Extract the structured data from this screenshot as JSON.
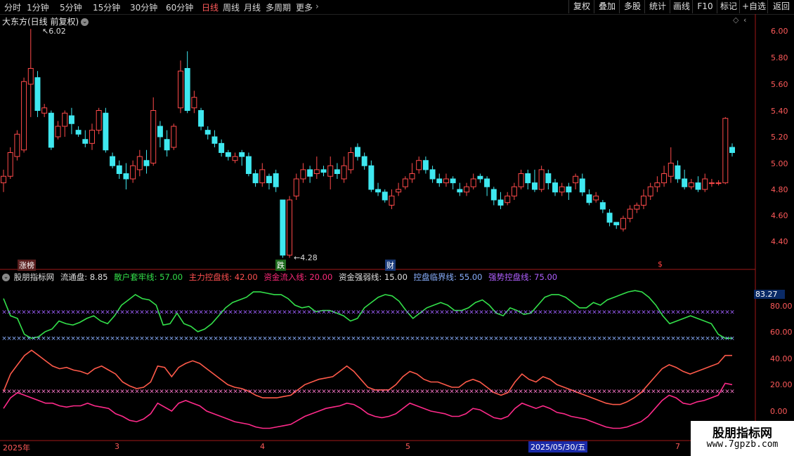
{
  "toolbar": {
    "periods": [
      "分时",
      "1分钟",
      "5分钟",
      "15分钟",
      "30分钟",
      "60分钟",
      "日线",
      "周线",
      "月线",
      "多周期",
      "更多"
    ],
    "active_period": "日线",
    "buttons": [
      "复权",
      "叠加",
      "多股",
      "统计",
      "画线",
      "F10",
      "标记",
      "+自选",
      "返回"
    ]
  },
  "chart_title": "大东方(日线 前复权)",
  "annotations": {
    "high": "6.02",
    "low": "4.28",
    "tag_zhangbang": "涨榜",
    "tag_die": "跌",
    "tag_cai": "财",
    "tag_dollar": "$"
  },
  "indicator": {
    "name": "股朋指标网",
    "float_label": "流通盘: 8.85",
    "items": [
      {
        "text": "散户套牢线: 57.00",
        "color": "#33e04a"
      },
      {
        "text": "主力控盘线: 42.00",
        "color": "#ff5050"
      },
      {
        "text": "资金流入线: 20.00",
        "color": "#ff2a7a"
      },
      {
        "text": "资金强弱线: 15.00",
        "color": "#e0e0e0"
      },
      {
        "text": "控盘临界线: 55.00",
        "color": "#8ab0ff"
      },
      {
        "text": "强势控盘线: 75.00",
        "color": "#b060ff"
      }
    ],
    "current_value": "83.27"
  },
  "price_axis": [
    "6.00",
    "5.80",
    "5.60",
    "5.40",
    "5.20",
    "5.00",
    "4.80",
    "4.60",
    "4.40"
  ],
  "ind_axis": [
    "80.00",
    "60.00",
    "40.00",
    "20.00",
    "0.00"
  ],
  "x_axis": [
    "2025年",
    "3",
    "4",
    "5",
    "7"
  ],
  "cursor_date": "2025/05/30/五",
  "watermark": {
    "title": "股朋指标网",
    "url": "www.7gpzb.com"
  },
  "chart_data": {
    "type": "candlestick",
    "price_ylim": [
      4.2,
      6.1
    ],
    "candles": [
      [
        4.85,
        4.9,
        4.78,
        4.95
      ],
      [
        4.9,
        5.08,
        4.88,
        5.12
      ],
      [
        5.05,
        5.22,
        5.02,
        5.25
      ],
      [
        5.1,
        5.62,
        5.08,
        5.65
      ],
      [
        5.6,
        5.72,
        5.35,
        6.02
      ],
      [
        5.65,
        5.4,
        5.35,
        5.7
      ],
      [
        5.38,
        5.42,
        5.35,
        5.45
      ],
      [
        5.38,
        5.12,
        5.1,
        5.4
      ],
      [
        5.2,
        5.28,
        5.18,
        5.32
      ],
      [
        5.28,
        5.38,
        5.2,
        5.4
      ],
      [
        5.36,
        5.3,
        5.22,
        5.42
      ],
      [
        5.25,
        5.22,
        5.2,
        5.28
      ],
      [
        5.18,
        5.15,
        5.12,
        5.25
      ],
      [
        5.15,
        5.25,
        5.1,
        5.3
      ],
      [
        5.25,
        5.4,
        5.22,
        5.42
      ],
      [
        5.38,
        5.1,
        5.08,
        5.42
      ],
      [
        5.05,
        4.98,
        4.96,
        5.08
      ],
      [
        4.98,
        4.92,
        4.88,
        5.02
      ],
      [
        4.92,
        4.88,
        4.8,
        5.0
      ],
      [
        4.88,
        4.98,
        4.85,
        5.02
      ],
      [
        4.95,
        5.05,
        4.9,
        5.1
      ],
      [
        5.02,
        4.98,
        4.92,
        5.1
      ],
      [
        5.0,
        5.4,
        4.98,
        5.5
      ],
      [
        5.28,
        5.2,
        5.12,
        5.32
      ],
      [
        5.18,
        5.1,
        5.05,
        5.25
      ],
      [
        5.12,
        5.28,
        5.1,
        5.3
      ],
      [
        5.42,
        5.7,
        5.38,
        5.78
      ],
      [
        5.72,
        5.4,
        5.38,
        5.85
      ],
      [
        5.42,
        5.5,
        5.38,
        5.55
      ],
      [
        5.4,
        5.28,
        5.25,
        5.42
      ],
      [
        5.25,
        5.22,
        5.18,
        5.28
      ],
      [
        5.2,
        5.15,
        5.12,
        5.25
      ],
      [
        5.15,
        5.08,
        5.05,
        5.18
      ],
      [
        5.08,
        5.05,
        5.02,
        5.1
      ],
      [
        5.02,
        5.05,
        5.0,
        5.08
      ],
      [
        5.08,
        5.05,
        4.98,
        5.1
      ],
      [
        5.05,
        4.92,
        4.9,
        5.08
      ],
      [
        4.92,
        4.85,
        4.82,
        4.95
      ],
      [
        4.85,
        4.95,
        4.82,
        5.0
      ],
      [
        4.9,
        4.85,
        4.8,
        4.92
      ],
      [
        4.92,
        4.82,
        4.78,
        4.95
      ],
      [
        4.72,
        4.3,
        4.28,
        4.72
      ],
      [
        4.3,
        4.72,
        4.28,
        4.75
      ],
      [
        4.75,
        4.88,
        4.72,
        4.92
      ],
      [
        4.88,
        4.95,
        4.85,
        5.0
      ],
      [
        4.95,
        4.9,
        4.85,
        4.98
      ],
      [
        4.92,
        4.95,
        4.88,
        5.05
      ],
      [
        4.95,
        4.93,
        4.9,
        4.98
      ],
      [
        4.9,
        4.98,
        4.8,
        5.05
      ],
      [
        4.95,
        4.92,
        4.88,
        5.0
      ],
      [
        4.88,
        4.98,
        4.85,
        5.05
      ],
      [
        4.95,
        5.08,
        4.92,
        5.12
      ],
      [
        5.12,
        5.05,
        5.02,
        5.15
      ],
      [
        5.05,
        4.98,
        4.95,
        5.08
      ],
      [
        4.98,
        4.8,
        4.78,
        5.02
      ],
      [
        4.8,
        4.78,
        4.75,
        4.85
      ],
      [
        4.78,
        4.72,
        4.7,
        4.8
      ],
      [
        4.68,
        4.75,
        4.65,
        4.8
      ],
      [
        4.78,
        4.8,
        4.75,
        4.85
      ],
      [
        4.82,
        4.88,
        4.8,
        4.9
      ],
      [
        4.88,
        4.92,
        4.85,
        5.0
      ],
      [
        4.95,
        5.02,
        4.92,
        5.05
      ],
      [
        5.02,
        4.95,
        4.92,
        5.05
      ],
      [
        4.95,
        4.88,
        4.85,
        4.98
      ],
      [
        4.88,
        4.85,
        4.82,
        4.92
      ],
      [
        4.85,
        4.88,
        4.82,
        4.92
      ],
      [
        4.88,
        4.85,
        4.8,
        4.9
      ],
      [
        4.8,
        4.78,
        4.75,
        4.85
      ],
      [
        4.78,
        4.82,
        4.75,
        4.85
      ],
      [
        4.82,
        4.88,
        4.8,
        4.92
      ],
      [
        4.9,
        4.88,
        4.85,
        4.92
      ],
      [
        4.88,
        4.82,
        4.75,
        4.9
      ],
      [
        4.8,
        4.72,
        4.68,
        4.82
      ],
      [
        4.72,
        4.68,
        4.65,
        4.78
      ],
      [
        4.7,
        4.75,
        4.68,
        4.78
      ],
      [
        4.75,
        4.82,
        4.72,
        4.85
      ],
      [
        4.82,
        4.92,
        4.8,
        4.95
      ],
      [
        4.92,
        4.85,
        4.8,
        4.95
      ],
      [
        4.85,
        4.8,
        4.78,
        4.95
      ],
      [
        4.8,
        4.95,
        4.78,
        4.98
      ],
      [
        4.92,
        4.85,
        4.8,
        4.95
      ],
      [
        4.85,
        4.78,
        4.75,
        4.88
      ],
      [
        4.78,
        4.82,
        4.75,
        4.85
      ],
      [
        4.82,
        4.78,
        4.72,
        4.85
      ],
      [
        4.85,
        4.9,
        4.8,
        4.92
      ],
      [
        4.88,
        4.78,
        4.75,
        4.92
      ],
      [
        4.76,
        4.7,
        4.68,
        4.8
      ],
      [
        4.72,
        4.75,
        4.7,
        4.78
      ],
      [
        4.7,
        4.65,
        4.62,
        4.72
      ],
      [
        4.62,
        4.55,
        4.52,
        4.65
      ],
      [
        4.55,
        4.53,
        4.5,
        4.55
      ],
      [
        4.5,
        4.58,
        4.48,
        4.6
      ],
      [
        4.58,
        4.65,
        4.55,
        4.68
      ],
      [
        4.65,
        4.68,
        4.62,
        4.7
      ],
      [
        4.68,
        4.75,
        4.65,
        4.8
      ],
      [
        4.75,
        4.82,
        4.72,
        4.85
      ],
      [
        4.82,
        4.85,
        4.78,
        4.9
      ],
      [
        4.85,
        4.92,
        4.82,
        4.98
      ],
      [
        4.9,
        5.0,
        4.85,
        5.12
      ],
      [
        4.98,
        4.88,
        4.85,
        5.02
      ],
      [
        4.88,
        4.82,
        4.8,
        4.95
      ],
      [
        4.82,
        4.85,
        4.8,
        4.88
      ],
      [
        4.85,
        4.8,
        4.78,
        4.9
      ],
      [
        4.8,
        4.88,
        4.78,
        4.92
      ],
      [
        4.85,
        4.85,
        4.82,
        4.88
      ],
      [
        4.85,
        4.85,
        4.83,
        4.87
      ],
      [
        4.85,
        5.34,
        4.84,
        5.35
      ],
      [
        5.12,
        5.08,
        5.05,
        5.15
      ]
    ],
    "series": [
      {
        "name": "散户套牢线",
        "color": "#33e04a",
        "values": [
          85,
          72,
          70,
          58,
          55,
          56,
          60,
          62,
          68,
          66,
          65,
          67,
          70,
          72,
          68,
          66,
          72,
          80,
          84,
          88,
          85,
          84,
          80,
          65,
          66,
          74,
          66,
          64,
          60,
          62,
          66,
          72,
          78,
          82,
          84,
          86,
          90,
          90,
          89,
          88,
          88,
          85,
          80,
          78,
          79,
          75,
          76,
          76,
          74,
          72,
          68,
          70,
          78,
          82,
          86,
          88,
          87,
          83,
          76,
          70,
          74,
          78,
          80,
          82,
          80,
          76,
          76,
          78,
          82,
          84,
          80,
          74,
          72,
          78,
          76,
          73,
          74,
          80,
          86,
          88,
          88,
          86,
          82,
          78,
          78,
          82,
          80,
          84,
          86,
          88,
          90,
          91,
          90,
          86,
          80,
          72,
          66,
          68,
          70,
          72,
          70,
          68,
          66,
          58,
          55,
          55
        ]
      },
      {
        "name": "主力控盘线",
        "color": "#ff5a4a",
        "values": [
          15,
          28,
          35,
          42,
          46,
          42,
          38,
          34,
          32,
          33,
          31,
          30,
          28,
          32,
          34,
          31,
          28,
          22,
          19,
          17,
          18,
          22,
          34,
          33,
          26,
          33,
          36,
          38,
          36,
          32,
          28,
          24,
          20,
          18,
          17,
          15,
          12,
          10,
          10,
          10,
          11,
          12,
          16,
          20,
          22,
          24,
          25,
          26,
          30,
          34,
          30,
          24,
          18,
          16,
          16,
          16,
          20,
          26,
          30,
          28,
          24,
          22,
          22,
          20,
          18,
          18,
          22,
          24,
          22,
          18,
          14,
          12,
          14,
          22,
          28,
          24,
          22,
          26,
          24,
          20,
          18,
          16,
          14,
          12,
          10,
          8,
          6,
          5,
          5,
          7,
          10,
          14,
          20,
          26,
          32,
          35,
          33,
          30,
          28,
          30,
          32,
          34,
          36,
          42,
          42
        ]
      },
      {
        "name": "资金流入线",
        "color": "#ff2a8a",
        "values": [
          2,
          10,
          14,
          12,
          10,
          8,
          6,
          6,
          4,
          3,
          4,
          4,
          6,
          4,
          3,
          2,
          -2,
          -4,
          -7,
          -8,
          -6,
          -2,
          6,
          3,
          0,
          6,
          8,
          6,
          4,
          0,
          -2,
          -4,
          -6,
          -8,
          -9,
          -10,
          -12,
          -13,
          -13,
          -12,
          -11,
          -10,
          -7,
          -4,
          -2,
          0,
          2,
          3,
          4,
          6,
          5,
          2,
          -2,
          -4,
          -5,
          -4,
          -2,
          2,
          6,
          4,
          2,
          0,
          -1,
          -2,
          -4,
          -4,
          -2,
          2,
          1,
          -2,
          -5,
          -6,
          -4,
          2,
          6,
          4,
          2,
          4,
          2,
          -1,
          -2,
          -4,
          -5,
          -6,
          -8,
          -10,
          -12,
          -13,
          -13,
          -12,
          -10,
          -8,
          -4,
          2,
          8,
          12,
          10,
          6,
          5,
          7,
          8,
          10,
          12,
          21,
          20
        ]
      },
      {
        "name": "资金强弱线",
        "color": "#e0e0e0",
        "values": [
          15
        ]
      },
      {
        "name": "控盘临界线",
        "color": "#8ab0ff",
        "values": [
          55
        ]
      },
      {
        "name": "强势控盘线",
        "color": "#b060ff",
        "values": [
          75
        ]
      }
    ],
    "ind_ylim": [
      -10,
      90
    ]
  }
}
